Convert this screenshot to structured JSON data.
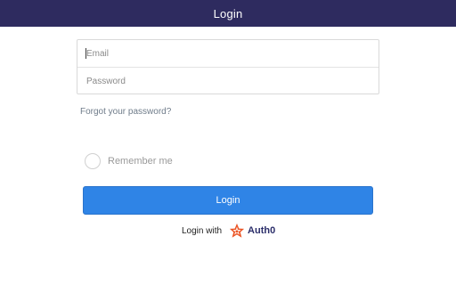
{
  "header": {
    "title": "Login"
  },
  "form": {
    "email": {
      "placeholder": "Email",
      "value": ""
    },
    "password": {
      "placeholder": "Password",
      "value": ""
    },
    "forgot_link": "Forgot your password?",
    "remember_label": "Remember me",
    "remember_checked": false,
    "login_button": "Login"
  },
  "provider": {
    "prefix": "Login with",
    "name": "Auth0",
    "icon": "auth0-logo-icon",
    "logo_color": "#eb5424"
  },
  "colors": {
    "header_bg": "#2e2b5f",
    "primary": "#2f84e6"
  }
}
